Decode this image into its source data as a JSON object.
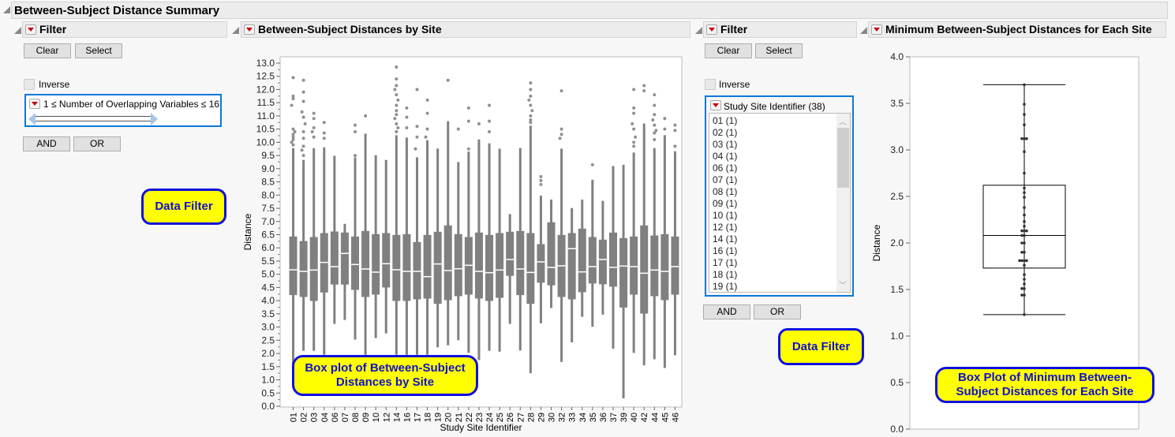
{
  "outline_title": "Between-Subject Distance Summary",
  "left_filter": {
    "title": "Filter",
    "clear": "Clear",
    "select": "Select",
    "inverse": "Inverse",
    "condition": "1 ≤ Number of Overlapping Variables  ≤ 16",
    "and": "AND",
    "or": "OR",
    "range": [
      1,
      16
    ]
  },
  "left_callout": "Data Filter",
  "box_panel": {
    "title": "Between-Subject Distances by Site",
    "callout": "Box plot of Between-Subject Distances by Site"
  },
  "right_filter": {
    "title": "Filter",
    "clear": "Clear",
    "select": "Select",
    "inverse": "Inverse",
    "list_title": "Study Site Identifier (38)",
    "items": [
      "01 (1)",
      "02 (1)",
      "03 (1)",
      "04 (1)",
      "06 (1)",
      "07 (1)",
      "08 (1)",
      "09 (1)",
      "10 (1)",
      "12 (1)",
      "14 (1)",
      "16 (1)",
      "17 (1)",
      "18 (1)",
      "19 (1)"
    ],
    "and": "AND",
    "or": "OR"
  },
  "right_callout": "Data Filter",
  "min_panel": {
    "title": "Minimum Between-Subject Distances for Each Site",
    "callout": "Box Plot of Minimum Between-Subject Distances for Each Site"
  },
  "chart_data": [
    {
      "type": "box",
      "title": "Between-Subject Distances by Site",
      "xlabel": "Study Site Identifier",
      "ylabel": "Distance",
      "ylim": [
        0,
        13
      ],
      "ystep": 0.5,
      "fields": [
        "site",
        "q1",
        "median",
        "q3",
        "whisker_low",
        "whisker_high",
        "outliers"
      ],
      "boxes": [
        [
          "01",
          4.21,
          5.17,
          6.43,
          1.53,
          9.78,
          [
            12.45,
            11.75,
            11.65,
            11.4,
            10.5,
            10.4,
            10.3,
            10.2,
            10.1,
            10.0,
            9.9
          ]
        ],
        [
          "02",
          4.14,
          5.11,
          6.26,
          2.1,
          9.33,
          [
            12.35,
            11.9,
            11.55,
            11.15,
            10.95,
            10.7,
            10.4,
            10.15,
            9.85,
            9.7,
            9.5
          ]
        ],
        [
          "03",
          3.99,
          5.16,
          6.41,
          2.1,
          9.78,
          [
            11.1,
            10.9,
            10.55,
            10.4,
            10.2
          ]
        ],
        [
          "04",
          4.31,
          5.45,
          6.56,
          1.95,
          9.81,
          [
            10.75,
            10.35,
            10.15
          ]
        ],
        [
          "06",
          4.61,
          5.29,
          6.62,
          3.12,
          9.49,
          []
        ],
        [
          "07",
          4.61,
          5.79,
          6.58,
          3.27,
          6.91,
          []
        ],
        [
          "08",
          4.41,
          5.37,
          6.43,
          2.52,
          9.43,
          [
            10.65,
            10.4,
            9.5
          ]
        ],
        [
          "09",
          4.14,
          5.2,
          6.64,
          1.95,
          10.33,
          [
            11.0
          ]
        ],
        [
          "10",
          4.23,
          5.08,
          6.52,
          2.58,
          9.51,
          []
        ],
        [
          "12",
          4.5,
          5.4,
          6.56,
          2.76,
          9.33,
          []
        ],
        [
          "14",
          3.99,
          5.17,
          6.49,
          1.95,
          10.27,
          [
            12.85,
            12.4,
            12.15,
            12.0,
            11.8,
            11.6,
            11.4,
            11.2,
            11.05,
            10.9,
            10.7,
            10.55,
            10.4
          ]
        ],
        [
          "16",
          3.99,
          5.11,
          6.52,
          1.95,
          10.18,
          [
            11.3,
            10.95,
            10.55
          ]
        ],
        [
          "17",
          4.05,
          5.11,
          6.22,
          1.95,
          9.43,
          [
            12.0,
            10.6,
            10.2,
            9.75
          ]
        ],
        [
          "18",
          4.08,
          4.91,
          6.49,
          1.95,
          10.08,
          [
            11.6,
            11.1,
            10.5,
            10.2
          ]
        ],
        [
          "19",
          3.88,
          5.39,
          6.61,
          2.23,
          9.76,
          []
        ],
        [
          "20",
          4.02,
          5.14,
          6.85,
          2.31,
          10.8,
          [
            12.35
          ]
        ],
        [
          "21",
          4.17,
          5.21,
          6.52,
          2.5,
          9.25,
          [
            10.5
          ]
        ],
        [
          "22",
          4.23,
          5.34,
          6.41,
          2.02,
          9.65,
          [
            11.3,
            10.8,
            9.75
          ]
        ],
        [
          "23",
          4.08,
          5.11,
          6.58,
          1.75,
          10.11,
          [
            10.7
          ]
        ],
        [
          "24",
          3.99,
          5.06,
          6.49,
          2.1,
          9.96,
          [
            11.4,
            10.8,
            10.4
          ]
        ],
        [
          "25",
          4.11,
          5.16,
          6.56,
          2.07,
          9.76,
          []
        ],
        [
          "26",
          4.94,
          5.56,
          6.61,
          3.12,
          7.28,
          []
        ],
        [
          "27",
          4.21,
          5.2,
          6.64,
          2.11,
          9.78,
          []
        ],
        [
          "28",
          3.88,
          5.07,
          6.56,
          1.25,
          10.63,
          [
            12.25,
            12.0,
            11.75,
            11.6,
            11.4,
            11.2,
            11.0,
            10.85,
            10.75
          ]
        ],
        [
          "29",
          4.68,
          5.47,
          6.14,
          3.14,
          7.98,
          [
            8.7,
            8.55,
            8.4
          ]
        ],
        [
          "30",
          4.58,
          5.26,
          6.97,
          3.72,
          7.83,
          []
        ],
        [
          "32",
          4.14,
          5.32,
          6.49,
          1.68,
          9.76,
          [
            11.95,
            10.5,
            10.3,
            10.15
          ]
        ],
        [
          "33",
          4.05,
          5.97,
          6.56,
          2.42,
          7.51,
          []
        ],
        [
          "34",
          4.32,
          5.09,
          6.73,
          3.39,
          7.83,
          []
        ],
        [
          "35",
          4.65,
          5.29,
          6.41,
          3.01,
          8.58,
          [
            9.15
          ]
        ],
        [
          "36",
          4.62,
          5.56,
          6.31,
          3.47,
          7.78,
          []
        ],
        [
          "37",
          4.53,
          5.26,
          6.58,
          2.18,
          9.1,
          []
        ],
        [
          "39",
          3.74,
          5.31,
          6.37,
          0.3,
          9.15,
          []
        ],
        [
          "40",
          4.23,
          5.29,
          6.43,
          2.02,
          9.61,
          [
            12.0,
            11.3,
            11.1,
            10.7,
            10.5,
            10.2,
            10.0,
            9.85
          ]
        ],
        [
          "42",
          3.51,
          5.04,
          6.85,
          1.55,
          10.71,
          [
            12.15,
            11.95
          ]
        ],
        [
          "44",
          4.17,
          5.16,
          6.47,
          1.78,
          9.78,
          [
            11.8,
            11.4,
            11.05,
            10.85,
            10.65,
            10.45,
            10.35,
            10.1
          ]
        ],
        [
          "45",
          4.02,
          5.11,
          6.52,
          1.45,
          10.27,
          [
            10.9,
            10.5
          ]
        ],
        [
          "46",
          4.23,
          5.29,
          6.43,
          1.93,
          9.66,
          [
            10.65,
            10.45,
            9.85
          ]
        ]
      ]
    },
    {
      "type": "box",
      "title": "Minimum Between-Subject Distances for Each Site",
      "ylabel": "Distance",
      "ylim": [
        0,
        4
      ],
      "ystep": 0.5,
      "q1": 1.73,
      "median": 2.08,
      "q3": 2.62,
      "whisker_low": 1.23,
      "whisker_high": 3.7,
      "points": [
        3.7,
        3.49,
        3.38,
        3.27,
        3.12,
        3.12,
        3.12,
        2.98,
        2.75,
        2.59,
        2.54,
        2.49,
        2.38,
        2.3,
        2.23,
        2.18,
        2.13,
        2.13,
        2.13,
        2.08,
        2.08,
        2.0,
        2.0,
        1.9,
        1.9,
        1.81,
        1.81,
        1.81,
        1.81,
        1.76,
        1.66,
        1.61,
        1.56,
        1.51,
        1.51,
        1.44,
        1.44,
        1.23
      ]
    }
  ]
}
